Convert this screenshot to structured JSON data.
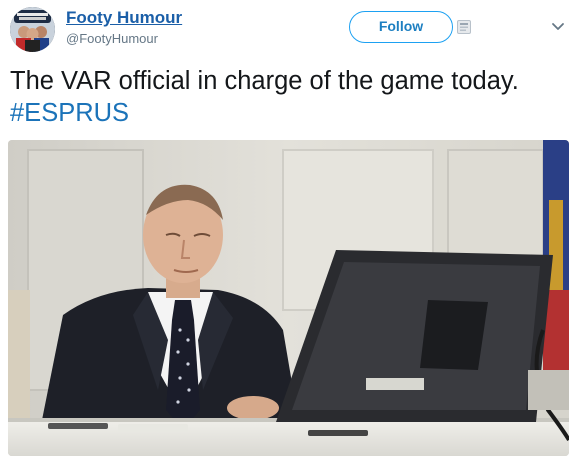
{
  "tweet": {
    "display_name": "Footy Humour",
    "handle": "@FootyHumour",
    "follow_label": "Follow",
    "text": "The VAR official in charge of the game today.",
    "hashtag": "#ESPRUS"
  },
  "icons": {
    "avatar": "profile-avatar",
    "pin": "square-badge-icon",
    "menu": "chevron-down-icon"
  },
  "colors": {
    "link_blue": "#1b5fa8",
    "follow_blue": "#1da1f2",
    "hashtag_blue": "#1b73b9",
    "text": "#14171a",
    "secondary": "#657786"
  }
}
